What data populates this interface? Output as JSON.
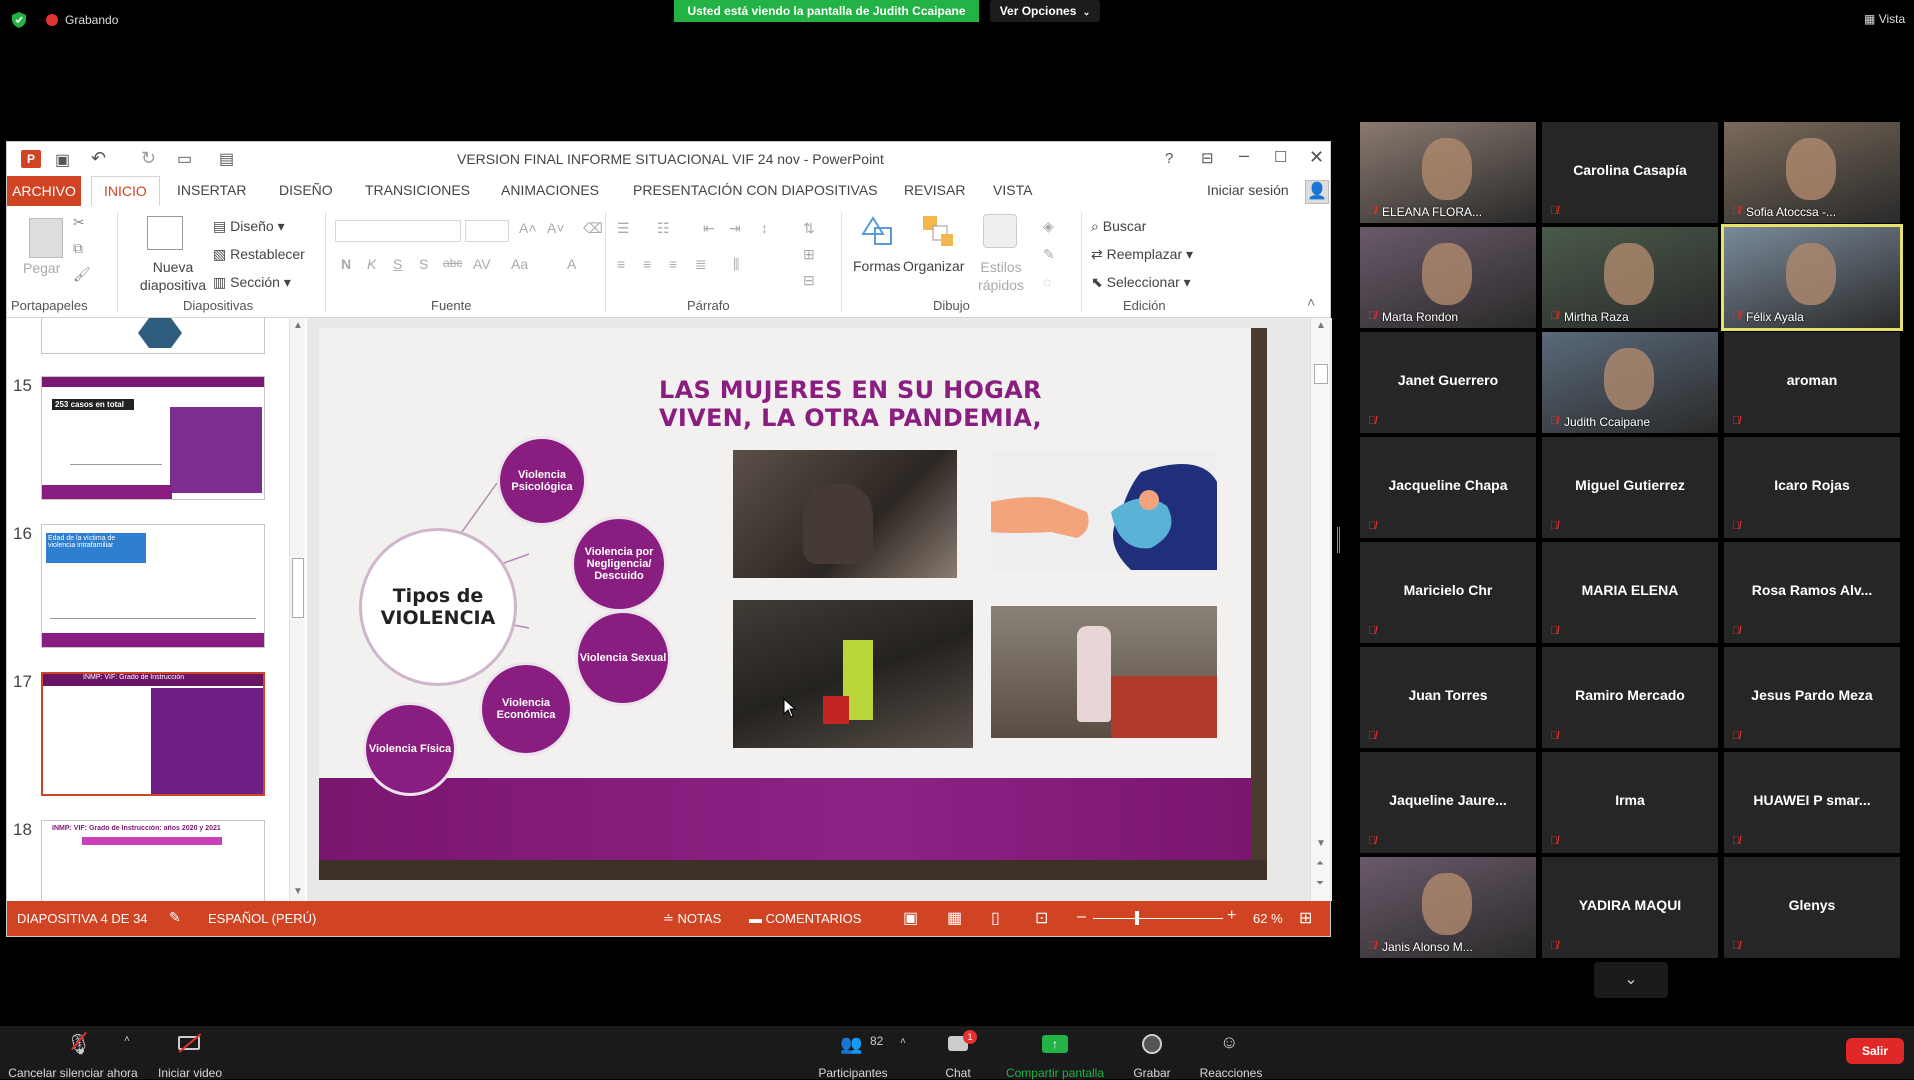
{
  "zoom_meeting": {
    "recording_label": "Grabando",
    "sharing_banner": "Usted está viendo la pantalla de Judith Ccaipane",
    "view_options": "Ver Opciones",
    "view_label": "Vista"
  },
  "ppt": {
    "window_title": "VERSION FINAL INFORME SITUACIONAL VIF 24 nov - PowerPoint",
    "help": "?",
    "tabs": [
      "ARCHIVO",
      "INICIO",
      "INSERTAR",
      "DISEÑO",
      "TRANSICIONES",
      "ANIMACIONES",
      "PRESENTACIÓN CON DIAPOSITIVAS",
      "REVISAR",
      "VISTA"
    ],
    "signin": "Iniciar sesión",
    "ribbon": {
      "pegar": "Pegar",
      "portapapeles": "Portapapeles",
      "nueva_diapositiva": "Nueva diapositiva",
      "diseno": "Diseño",
      "restablecer": "Restablecer",
      "seccion": "Sección",
      "diapositivas": "Diapositivas",
      "fuente": "Fuente",
      "parrafo": "Párrafo",
      "formas": "Formas",
      "organizar": "Organizar",
      "estilos_rapidos": "Estilos rápidos",
      "dibujo": "Dibujo",
      "buscar": "Buscar",
      "reemplazar": "Reemplazar",
      "seleccionar": "Seleccionar",
      "edicion": "Edición"
    },
    "thumbnails": [
      {
        "number": "15",
        "caption": "253 casos en total"
      },
      {
        "number": "16",
        "caption": "Edad de la víctima de violencia intrafamiliar"
      },
      {
        "number": "17",
        "caption": "INMP: VIF: Grado de Instrucción"
      },
      {
        "number": "18",
        "caption": "INMP: VIF: Grado de Instrucción: años 2020 y 2021"
      }
    ],
    "slide": {
      "title": "LAS MUJERES EN SU HOGAR VIVEN, LA OTRA PANDEMIA,",
      "center_line1": "Tipos de",
      "center_line2": "VIOLENCIA",
      "types": [
        {
          "label": "Violencia Psicológica"
        },
        {
          "label": "Violencia por Negligencia/ Descuido"
        },
        {
          "label": "Violencia Sexual"
        },
        {
          "label": "Violencia Económica"
        },
        {
          "label": "Violencia Física"
        }
      ]
    },
    "status": {
      "slide_indicator": "DIAPOSITIVA 4 DE 34",
      "language": "ESPAÑOL (PERÚ)",
      "notes": "NOTAS",
      "comments": "COMENTARIOS",
      "zoom": "62 %"
    }
  },
  "gallery": [
    {
      "name": "ELEANA FLORA...",
      "video": true
    },
    {
      "name": "Carolina Casapía",
      "video": false
    },
    {
      "name": "Sofia Atoccsa -...",
      "video": true
    },
    {
      "name": "Marta Rondon",
      "video": true
    },
    {
      "name": "Mirtha Raza",
      "video": true
    },
    {
      "name": "Félix Ayala",
      "video": true,
      "active": true
    },
    {
      "name": "Janet Guerrero",
      "video": false
    },
    {
      "name": "Judith Ccaipane",
      "video": true
    },
    {
      "name": "aroman",
      "video": false
    },
    {
      "name": "Jacqueline Chapa",
      "video": false
    },
    {
      "name": "Miguel Gutierrez",
      "video": false
    },
    {
      "name": "Icaro Rojas",
      "video": false
    },
    {
      "name": "Maricielo Chr",
      "video": false
    },
    {
      "name": "MARIA ELENA",
      "video": false
    },
    {
      "name": "Rosa Ramos Alv...",
      "video": false
    },
    {
      "name": "Juan Torres",
      "video": false
    },
    {
      "name": "Ramiro Mercado",
      "video": false
    },
    {
      "name": "Jesus Pardo Meza",
      "video": false
    },
    {
      "name": "Jaqueline  Jaure...",
      "video": false
    },
    {
      "name": "Irma",
      "video": false
    },
    {
      "name": "HUAWEI P smar...",
      "video": false
    },
    {
      "name": "Janis Alonso M...",
      "video": true
    },
    {
      "name": "YADIRA MAQUI",
      "video": false
    },
    {
      "name": "Glenys",
      "video": false
    }
  ],
  "controls": {
    "unmute": "Cancelar silenciar ahora",
    "start_video": "Iniciar video",
    "participants": "Participantes",
    "participants_count": "82",
    "chat": "Chat",
    "chat_badge": "1",
    "share": "Compartir pantalla",
    "record": "Grabar",
    "reactions": "Reacciones",
    "leave": "Salir"
  },
  "colors": {
    "ppt_accent": "#d04424",
    "slide_purple": "#8a1e80",
    "zoom_green": "#23b245",
    "leave_red": "#e02828"
  }
}
